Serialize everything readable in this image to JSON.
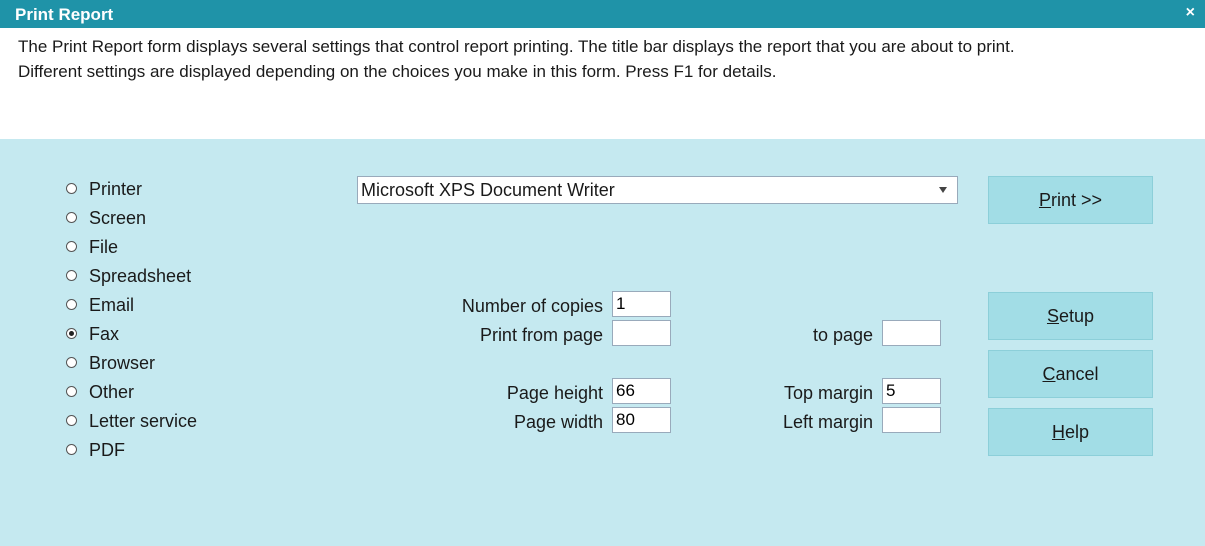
{
  "window": {
    "title": "Print Report",
    "close_glyph": "×"
  },
  "description": {
    "line1": "The Print Report form displays several settings that control report printing. The title bar displays the report that you are about to print.",
    "line2": "Different settings are displayed depending on the choices you make in this form. Press F1 for details."
  },
  "output_options": [
    {
      "label": "Printer",
      "checked": false
    },
    {
      "label": "Screen",
      "checked": false
    },
    {
      "label": "File",
      "checked": false
    },
    {
      "label": "Spreadsheet",
      "checked": false
    },
    {
      "label": "Email",
      "checked": false
    },
    {
      "label": "Fax",
      "checked": true
    },
    {
      "label": "Browser",
      "checked": false
    },
    {
      "label": "Other",
      "checked": false
    },
    {
      "label": "Letter service",
      "checked": false
    },
    {
      "label": "PDF",
      "checked": false
    }
  ],
  "printer_select": {
    "value": "Microsoft XPS Document Writer"
  },
  "fields": {
    "copies": {
      "label": "Number of copies",
      "value": "1"
    },
    "from_page": {
      "label": "Print from page",
      "value": ""
    },
    "to_page": {
      "label": "to page",
      "value": ""
    },
    "page_height": {
      "label": "Page height",
      "value": "66"
    },
    "page_width": {
      "label": "Page width",
      "value": "80"
    },
    "top_margin": {
      "label": "Top margin",
      "value": "5"
    },
    "left_margin": {
      "label": "Left margin",
      "value": ""
    }
  },
  "buttons": {
    "print": {
      "accel": "P",
      "rest": "rint >>"
    },
    "setup": {
      "accel": "S",
      "rest": "etup"
    },
    "cancel": {
      "accel": "C",
      "rest": "ancel"
    },
    "help": {
      "accel": "H",
      "rest": "elp"
    }
  }
}
